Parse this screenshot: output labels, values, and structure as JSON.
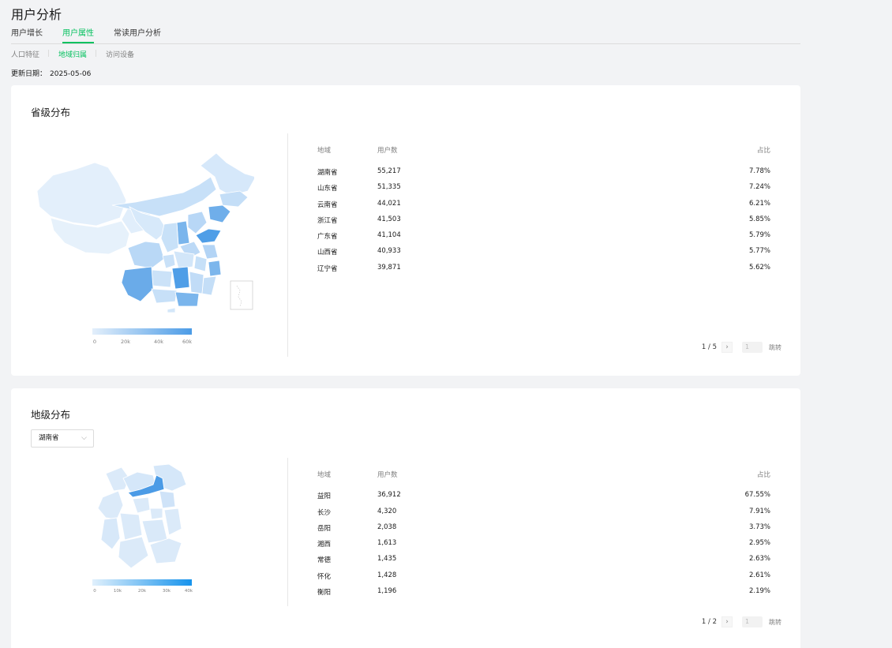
{
  "page_title": "用户分析",
  "tabs": [
    "用户增长",
    "用户属性",
    "常读用户分析"
  ],
  "subtabs": [
    "人口特征",
    "地域归属",
    "访问设备"
  ],
  "update": {
    "label": "更新日期：",
    "date": "2025-05-06"
  },
  "colors": {
    "accent": "#07c160",
    "map_low": "#e3effb",
    "map_high": "#4b9be6"
  },
  "province": {
    "title": "省级分布",
    "headers": {
      "region": "地域",
      "users": "用户数",
      "pct": "占比"
    },
    "rows": [
      {
        "region": "湖南省",
        "users": "55,217",
        "pct": "7.78%"
      },
      {
        "region": "山东省",
        "users": "51,335",
        "pct": "7.24%"
      },
      {
        "region": "云南省",
        "users": "44,021",
        "pct": "6.21%"
      },
      {
        "region": "浙江省",
        "users": "41,503",
        "pct": "5.85%"
      },
      {
        "region": "广东省",
        "users": "41,104",
        "pct": "5.79%"
      },
      {
        "region": "山西省",
        "users": "40,933",
        "pct": "5.77%"
      },
      {
        "region": "辽宁省",
        "users": "39,871",
        "pct": "5.62%"
      }
    ],
    "pager": {
      "status": "1 / 5",
      "next": "›",
      "input_placeholder": "1",
      "jump": "跳转"
    },
    "legend": [
      "0",
      "20k",
      "40k",
      "60k"
    ]
  },
  "city": {
    "title": "地级分布",
    "select_value": "湖南省",
    "headers": {
      "region": "地域",
      "users": "用户数",
      "pct": "占比"
    },
    "rows": [
      {
        "region": "益阳",
        "users": "36,912",
        "pct": "67.55%"
      },
      {
        "region": "长沙",
        "users": "4,320",
        "pct": "7.91%"
      },
      {
        "region": "岳阳",
        "users": "2,038",
        "pct": "3.73%"
      },
      {
        "region": "湘西",
        "users": "1,613",
        "pct": "2.95%"
      },
      {
        "region": "常德",
        "users": "1,435",
        "pct": "2.63%"
      },
      {
        "region": "怀化",
        "users": "1,428",
        "pct": "2.61%"
      },
      {
        "region": "衡阳",
        "users": "1,196",
        "pct": "2.19%"
      }
    ],
    "pager": {
      "status": "1 / 2",
      "next": "›",
      "input_placeholder": "1",
      "jump": "跳转"
    },
    "legend": [
      "0",
      "10k",
      "20k",
      "30k",
      "40k"
    ]
  }
}
